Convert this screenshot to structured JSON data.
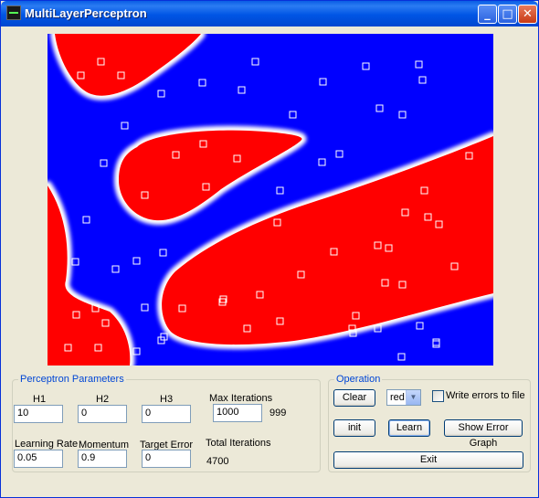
{
  "window": {
    "title": "MultiLayerPerceptron",
    "controls": [
      "minimize",
      "maximize",
      "close"
    ]
  },
  "plot": {
    "background_color": "#0000ff",
    "region_color": "#ff0000",
    "boundary_color": "#ffffff",
    "marker": "hollow-square",
    "sample_point_count": 68
  },
  "perceptron_parameters": {
    "group_label": "Perceptron Parameters",
    "h1": {
      "label": "H1",
      "value": "10"
    },
    "h2": {
      "label": "H2",
      "value": "0"
    },
    "h3": {
      "label": "H3",
      "value": "0"
    },
    "max_iterations": {
      "label": "Max Iterations",
      "value": "1000",
      "current": "999"
    },
    "learning_rate": {
      "label": "Learning Rate",
      "value": "0.05"
    },
    "momentum": {
      "label": "Momentum",
      "value": "0.9"
    },
    "target_error": {
      "label": "Target Error",
      "value": "0"
    },
    "total_iterations": {
      "label": "Total Iterations",
      "value": "4700"
    }
  },
  "operation": {
    "group_label": "Operation",
    "clear_label": "Clear",
    "color_select": {
      "value": "red"
    },
    "write_errors": {
      "label": "Write errors to file",
      "checked": false
    },
    "init_label": "init",
    "learn_label": "Learn",
    "show_error_graph_label": "Show Error Graph",
    "exit_label": "Exit"
  }
}
